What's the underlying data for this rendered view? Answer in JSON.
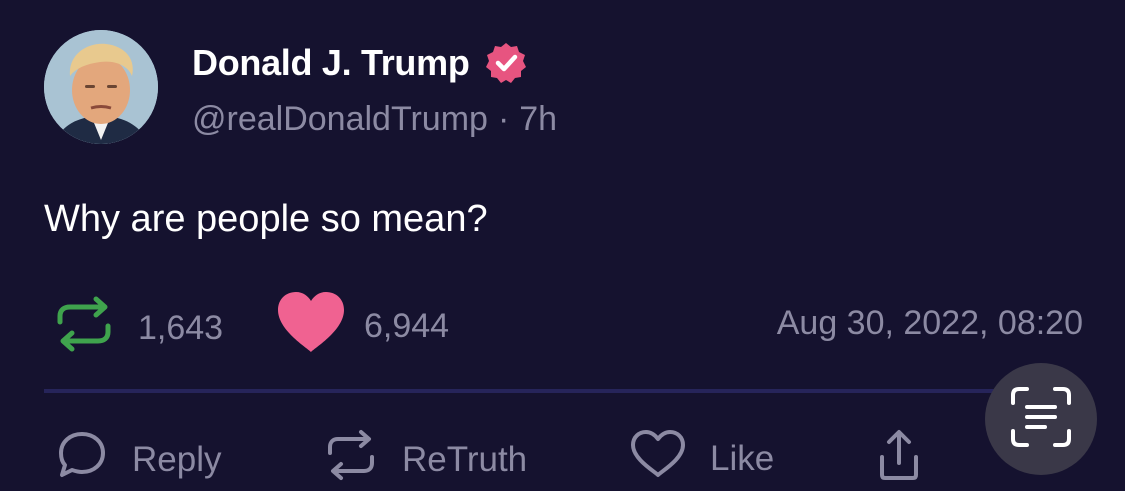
{
  "author": {
    "name": "Donald J. Trump",
    "handle": "@realDonaldTrump",
    "separator": "·",
    "time_ago": "7h",
    "verified": true
  },
  "post": {
    "text": "Why are people so mean?"
  },
  "stats": {
    "retruths": "1,643",
    "likes": "6,944",
    "timestamp": "Aug 30, 2022, 08:20"
  },
  "actions": {
    "reply_label": "Reply",
    "retruth_label": "ReTruth",
    "like_label": "Like"
  },
  "icons": {
    "verified": "verified-badge-icon",
    "retruth": "retruth-icon",
    "heart": "heart-icon",
    "reply": "reply-bubble-icon",
    "like": "heart-outline-icon",
    "share": "share-icon",
    "scan": "text-scan-icon"
  },
  "colors": {
    "background": "#15122f",
    "muted_text": "#8c8aa3",
    "verified_badge": "#e75480",
    "retruth_green": "#3fa34d",
    "heart_pink": "#f06291",
    "divider": "#26245a"
  }
}
